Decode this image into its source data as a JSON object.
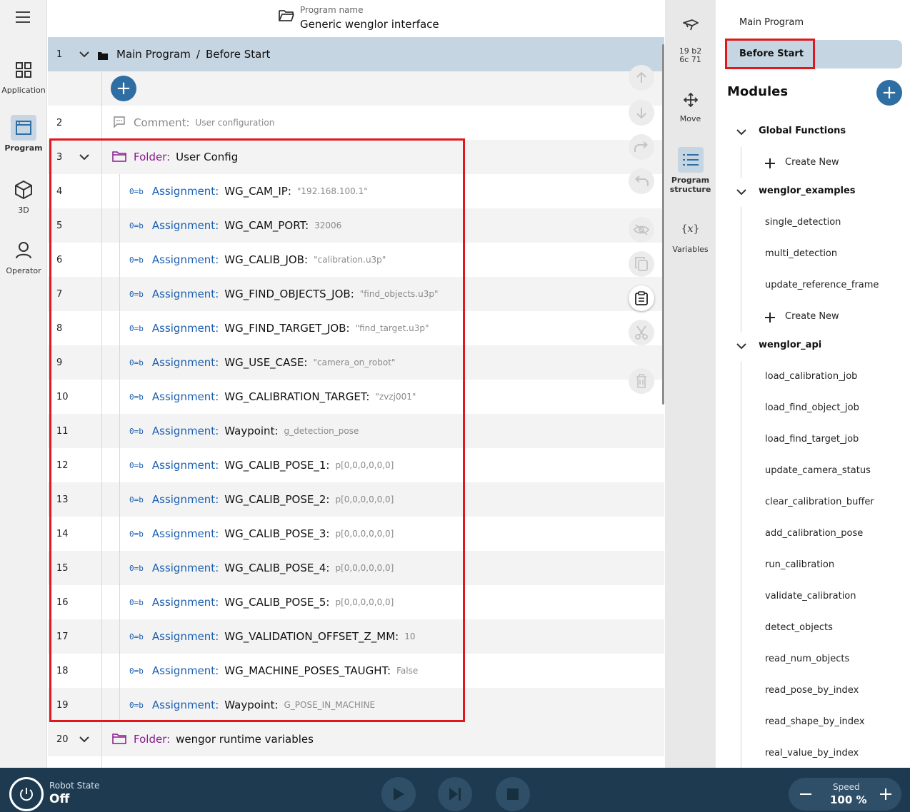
{
  "nav": {
    "items": [
      {
        "label": "Application",
        "icon": "grid-icon"
      },
      {
        "label": "Program",
        "icon": "program-window-icon"
      },
      {
        "label": "3D",
        "icon": "cube-icon"
      },
      {
        "label": "Operator",
        "icon": "person-icon"
      }
    ]
  },
  "header": {
    "program_name_label": "Program name",
    "program_name": "Generic wenglor interface"
  },
  "tree": {
    "head": {
      "number": "1",
      "path": "Main Program",
      "separator": "/",
      "section": "Before Start"
    },
    "comment": {
      "number": "2",
      "keyword": "Comment:",
      "text": "User configuration"
    },
    "folder": {
      "number": "3",
      "keyword": "Folder:",
      "name": "User Config"
    },
    "assign_keyword": "Assignment:",
    "assign_symbol": "0=b",
    "assignments": [
      {
        "number": "4",
        "name": "WG_CAM_IP:",
        "value": "\"192.168.100.1\""
      },
      {
        "number": "5",
        "name": "WG_CAM_PORT:",
        "value": "32006"
      },
      {
        "number": "6",
        "name": "WG_CALIB_JOB:",
        "value": "\"calibration.u3p\""
      },
      {
        "number": "7",
        "name": "WG_FIND_OBJECTS_JOB:",
        "value": "\"find_objects.u3p\""
      },
      {
        "number": "8",
        "name": "WG_FIND_TARGET_JOB:",
        "value": "\"find_target.u3p\""
      },
      {
        "number": "9",
        "name": "WG_USE_CASE:",
        "value": "\"camera_on_robot\""
      },
      {
        "number": "10",
        "name": "WG_CALIBRATION_TARGET:",
        "value": "\"zvzj001\""
      },
      {
        "number": "11",
        "name": "Waypoint:",
        "value": "g_detection_pose"
      },
      {
        "number": "12",
        "name": "WG_CALIB_POSE_1:",
        "value": "p[0,0,0,0,0,0]"
      },
      {
        "number": "13",
        "name": "WG_CALIB_POSE_2:",
        "value": "p[0,0,0,0,0,0]"
      },
      {
        "number": "14",
        "name": "WG_CALIB_POSE_3:",
        "value": "p[0,0,0,0,0,0]"
      },
      {
        "number": "15",
        "name": "WG_CALIB_POSE_4:",
        "value": "p[0,0,0,0,0,0]"
      },
      {
        "number": "16",
        "name": "WG_CALIB_POSE_5:",
        "value": "p[0,0,0,0,0,0]"
      },
      {
        "number": "17",
        "name": "WG_VALIDATION_OFFSET_Z_MM:",
        "value": "10"
      },
      {
        "number": "18",
        "name": "WG_MACHINE_POSES_TAUGHT:",
        "value": "False"
      },
      {
        "number": "19",
        "name": "Waypoint:",
        "value": "G_POSE_IN_MACHINE"
      }
    ],
    "folder2": {
      "number": "20",
      "keyword": "Folder:",
      "name": "wengor runtime variables"
    }
  },
  "toolbar": {
    "robot_id_line1": "19 b2",
    "robot_id_line2": "6c 71",
    "move_label": "Move",
    "structure_label_line1": "Program",
    "structure_label_line2": "structure",
    "variables_label": "Variables"
  },
  "right": {
    "main_program": "Main Program",
    "before_start": "Before Start",
    "modules_title": "Modules",
    "global_functions": "Global Functions",
    "create_new": "Create New",
    "group_examples": "wenglor_examples",
    "examples": [
      "single_detection",
      "multi_detection",
      "update_reference_frame"
    ],
    "group_api": "wenglor_api",
    "api": [
      "load_calibration_job",
      "load_find_object_job",
      "load_find_target_job",
      "update_camera_status",
      "clear_calibration_buffer",
      "add_calibration_pose",
      "run_calibration",
      "validate_calibration",
      "detect_objects",
      "read_num_objects",
      "read_pose_by_index",
      "read_shape_by_index",
      "real_value_by_index"
    ]
  },
  "bottom": {
    "robot_state_label": "Robot State",
    "robot_state": "Off",
    "speed_label": "Speed",
    "speed_value": "100 %"
  },
  "colors": {
    "accent": "#2f6ea3",
    "header_row": "#c6d5e2",
    "assignment": "#1b5fb0",
    "folder": "#8a1a8e",
    "highlight": "#e0171c",
    "bottom_bar": "#1d3a51"
  }
}
